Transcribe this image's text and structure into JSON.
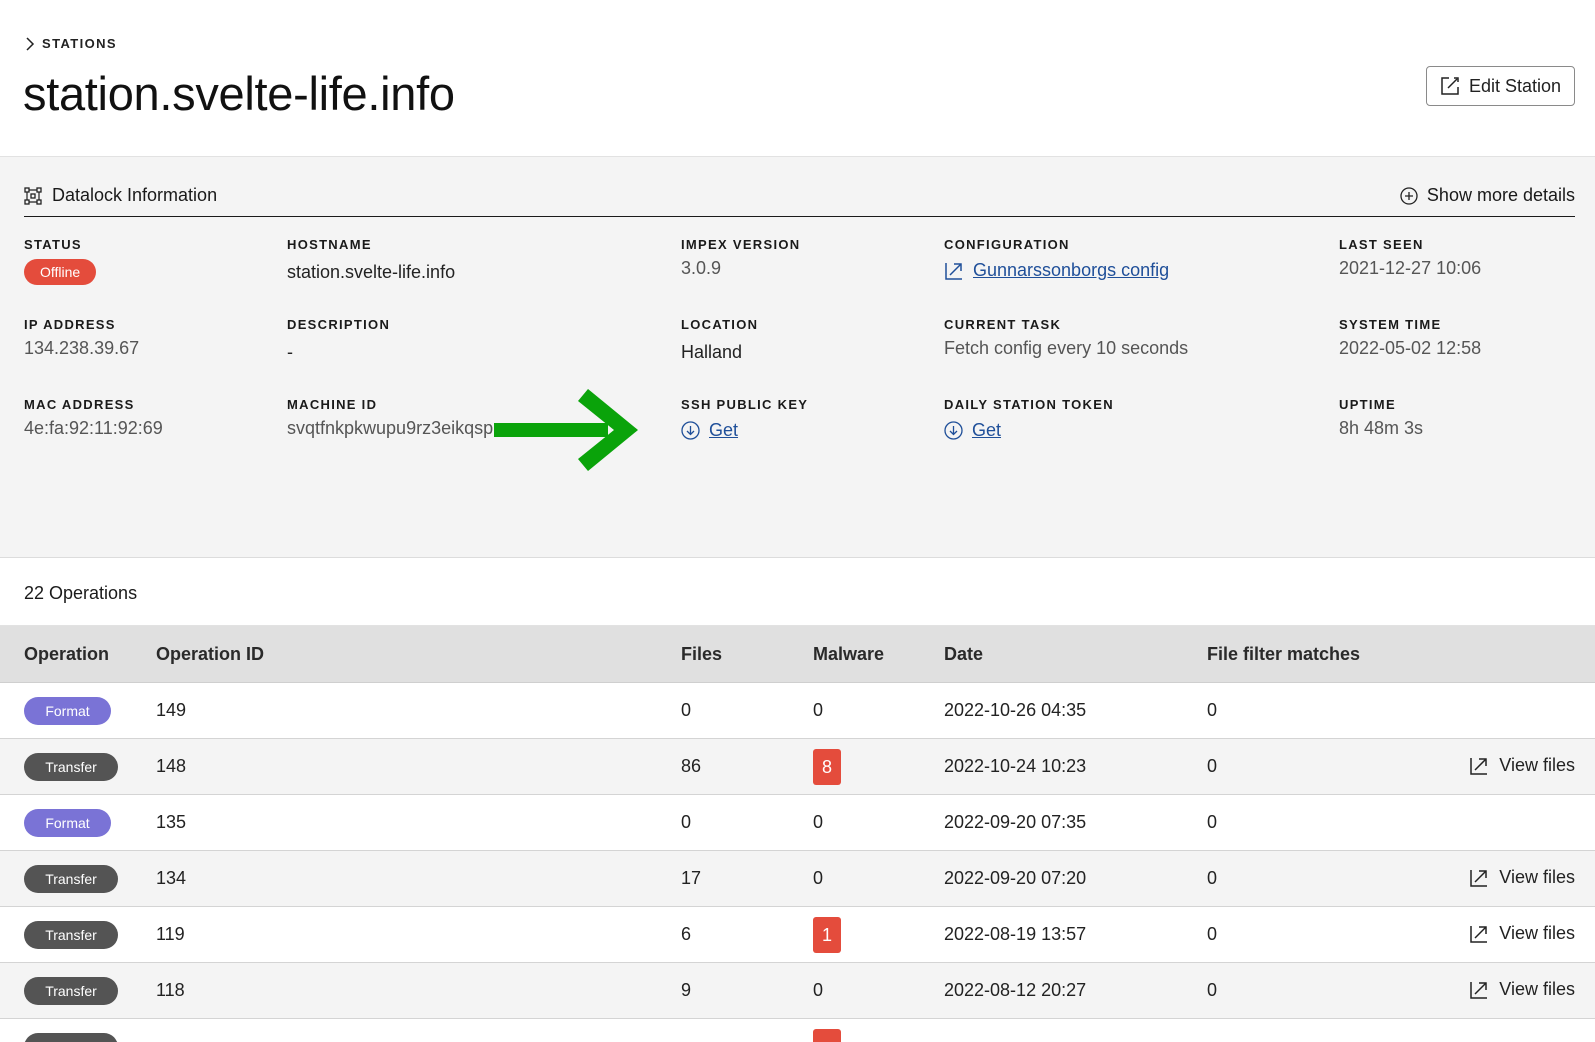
{
  "breadcrumb": {
    "label": "STATIONS"
  },
  "page": {
    "title": "station.svelte-life.info",
    "edit_label": "Edit Station"
  },
  "panel": {
    "title": "Datalock Information",
    "show_more": "Show more details"
  },
  "fields": {
    "status": {
      "label": "STATUS",
      "value": "Offline"
    },
    "hostname": {
      "label": "HOSTNAME",
      "value": "station.svelte-life.info"
    },
    "impex_version": {
      "label": "IMPEX VERSION",
      "value": "3.0.9"
    },
    "configuration": {
      "label": "CONFIGURATION",
      "value": "Gunnarssonborgs config"
    },
    "last_seen": {
      "label": "LAST SEEN",
      "value": "2021-12-27 10:06"
    },
    "ip_address": {
      "label": "IP ADDRESS",
      "value": "134.238.39.67"
    },
    "description": {
      "label": "DESCRIPTION",
      "value": "-"
    },
    "location": {
      "label": "LOCATION",
      "value": "Halland"
    },
    "current_task": {
      "label": "CURRENT TASK",
      "value": "Fetch config every 10 seconds"
    },
    "system_time": {
      "label": "SYSTEM TIME",
      "value": "2022-05-02 12:58"
    },
    "mac_address": {
      "label": "MAC ADDRESS",
      "value": "4e:fa:92:11:92:69"
    },
    "machine_id": {
      "label": "MACHINE ID",
      "value": "svqtfnkpkwupu9rz3eikqsp"
    },
    "ssh_public_key": {
      "label": "SSH PUBLIC KEY",
      "value": "Get"
    },
    "daily_station_token": {
      "label": "DAILY STATION TOKEN",
      "value": "Get"
    },
    "uptime": {
      "label": "UPTIME",
      "value": "8h 48m 3s"
    }
  },
  "colors": {
    "arrow": "#0aa30a",
    "offline": "#e44c3c",
    "format": "#7a73d6",
    "transfer": "#545454",
    "link": "#1f4f99"
  },
  "operations": {
    "count_label": "22 Operations",
    "columns": [
      "Operation",
      "Operation ID",
      "Files",
      "Malware",
      "Date",
      "File filter matches"
    ],
    "view_files_label": "View files",
    "rows": [
      {
        "type": "Format",
        "id": "149",
        "files": "0",
        "malware": "0",
        "date": "2022-10-26 04:35",
        "matches": "0"
      },
      {
        "type": "Transfer",
        "id": "148",
        "files": "86",
        "malware": "8",
        "date": "2022-10-24 10:23",
        "matches": "0"
      },
      {
        "type": "Format",
        "id": "135",
        "files": "0",
        "malware": "0",
        "date": "2022-09-20 07:35",
        "matches": "0"
      },
      {
        "type": "Transfer",
        "id": "134",
        "files": "17",
        "malware": "0",
        "date": "2022-09-20 07:20",
        "matches": "0"
      },
      {
        "type": "Transfer",
        "id": "119",
        "files": "6",
        "malware": "1",
        "date": "2022-08-19 13:57",
        "matches": "0"
      },
      {
        "type": "Transfer",
        "id": "118",
        "files": "9",
        "malware": "0",
        "date": "2022-08-12 20:27",
        "matches": "0"
      }
    ]
  }
}
